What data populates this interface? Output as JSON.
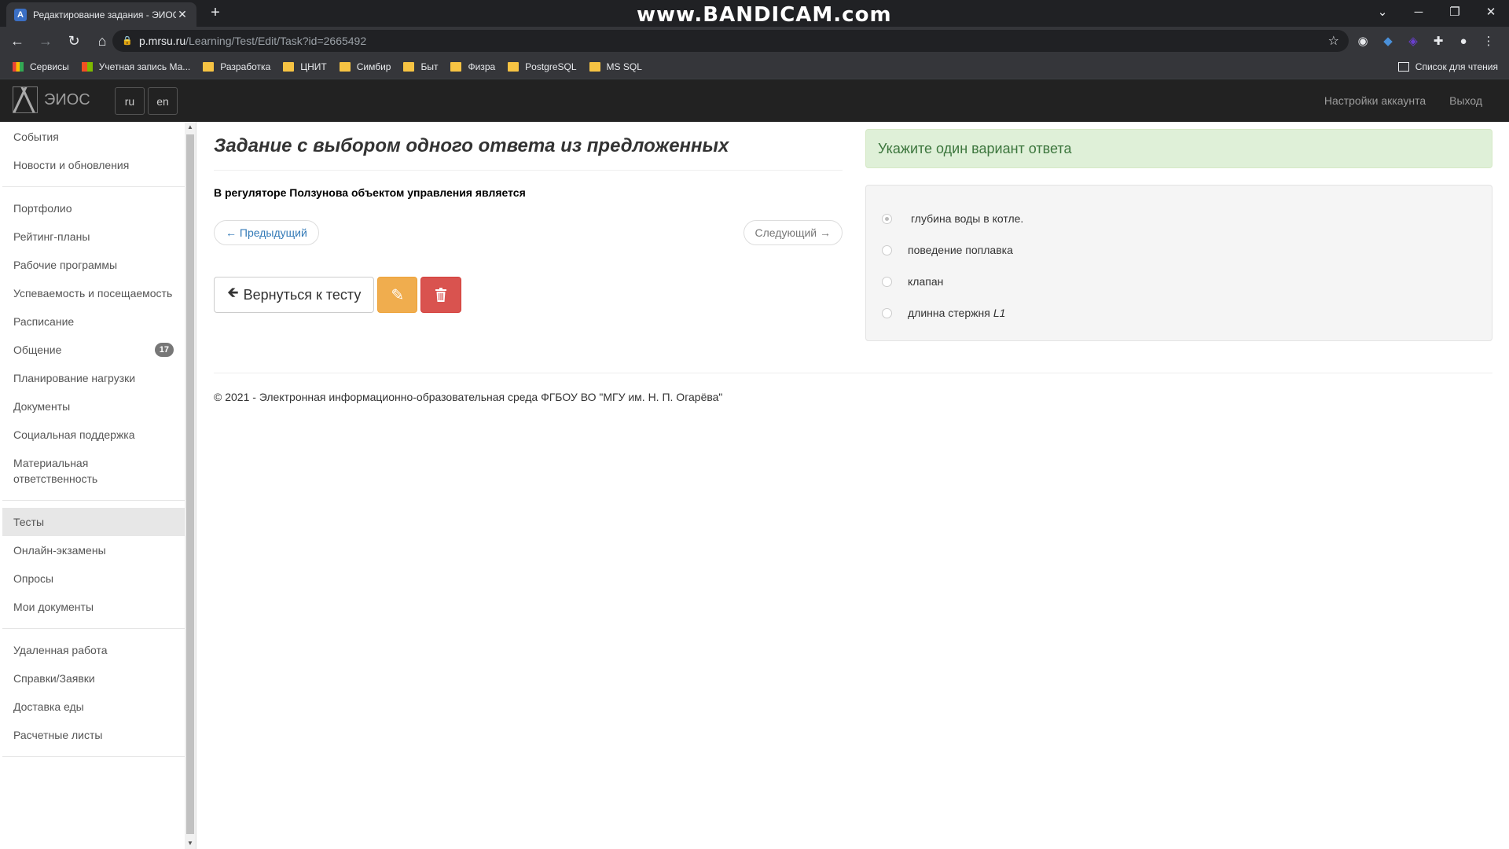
{
  "browser": {
    "tab_title": "Редактирование задания - ЭИОС",
    "tab_favicon": "А",
    "new_tab": "+",
    "recorder_watermark": "www.BANDICAM.com",
    "url_host": "p.mrsu.ru",
    "url_path": "/Learning/Test/Edit/Task?id=2665492",
    "bookmarks": [
      "Сервисы",
      "Учетная запись Ма...",
      "Разработка",
      "ЦНИТ",
      "Симбир",
      "Быт",
      "Физра",
      "PostgreSQL",
      "MS SQL"
    ],
    "reading_list": "Список для чтения"
  },
  "site": {
    "brand": "ЭИОС",
    "lang_ru": "ru",
    "lang_en": "en",
    "nav_account": "Настройки аккаунта",
    "nav_logout": "Выход"
  },
  "sidebar": {
    "items": [
      {
        "label": "События"
      },
      {
        "label": "Новости и обновления"
      },
      {
        "label": "Портфолио"
      },
      {
        "label": "Рейтинг-планы"
      },
      {
        "label": "Рабочие программы"
      },
      {
        "label": "Успеваемость и посещаемость"
      },
      {
        "label": "Расписание"
      },
      {
        "label": "Общение",
        "badge": "17"
      },
      {
        "label": "Планирование нагрузки"
      },
      {
        "label": "Документы"
      },
      {
        "label": "Социальная поддержка"
      },
      {
        "label": "Материальная ответственность"
      },
      {
        "label": "Тесты"
      },
      {
        "label": "Онлайн-экзамены"
      },
      {
        "label": "Опросы"
      },
      {
        "label": "Мои документы"
      },
      {
        "label": "Удаленная работа"
      },
      {
        "label": "Справки/Заявки"
      },
      {
        "label": "Доставка еды"
      },
      {
        "label": "Расчетные листы"
      }
    ]
  },
  "main": {
    "title": "Задание с выбором одного ответа из предложенных",
    "question": "В регуляторе Ползунова объектом управления является",
    "prev": "← Предыдущий",
    "next": "Следующий →",
    "back_button": "Вернуться к тесту"
  },
  "answers_panel": {
    "alert": "Укажите один вариант ответа",
    "options": [
      {
        "text": "глубина воды в котле.",
        "checked": true
      },
      {
        "text": "поведение поплавка",
        "checked": false
      },
      {
        "text": "клапан",
        "checked": false
      },
      {
        "text": "длинна стержня",
        "italic_suffix": "L1",
        "checked": false
      }
    ]
  },
  "footer": {
    "text": "© 2021 - Электронная информационно-образовательная среда ФГБОУ ВО \"МГУ им. Н. П. Огарёва\""
  }
}
